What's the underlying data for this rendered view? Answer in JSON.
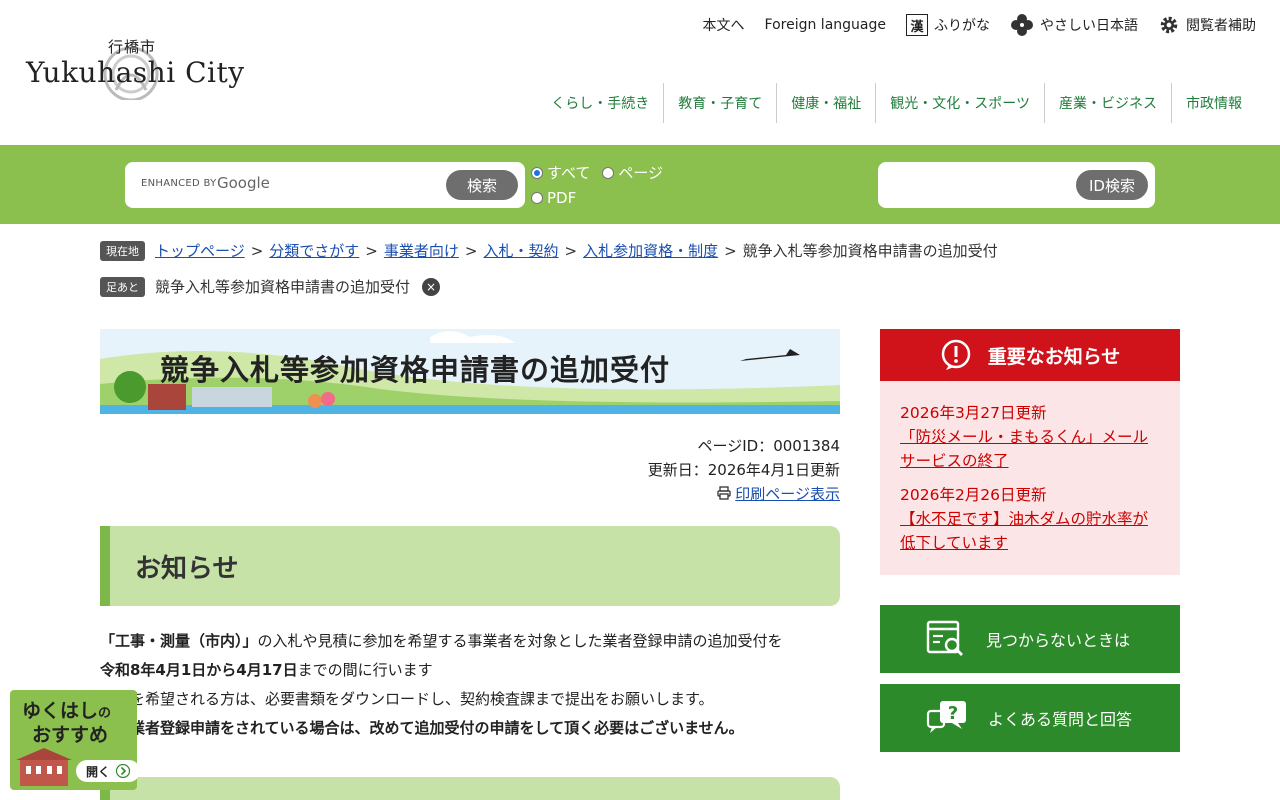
{
  "header": {
    "logo_kanji": "行橋市",
    "logo_en": "Yukuhashi City",
    "utility": {
      "skip": "本文へ",
      "foreign": "Foreign language",
      "furigana_icon": "漢",
      "furigana": "ふりがな",
      "easy_japanese": "やさしい日本語",
      "accessibility": "閲覧者補助"
    },
    "nav": [
      "くらし・手続き",
      "教育・子育て",
      "健康・福祉",
      "観光・文化・スポーツ",
      "産業・ビジネス",
      "市政情報"
    ]
  },
  "search": {
    "enhanced_by": "ENHANCED BY",
    "google": "Google",
    "button": "検索",
    "scope": {
      "all": "すべて",
      "page": "ページ",
      "pdf": "PDF"
    },
    "id_button": "ID検索"
  },
  "breadcrumb": {
    "tag": "現在地",
    "links": [
      "トップページ",
      "分類でさがす",
      "事業者向け",
      "入札・契約",
      "入札参加資格・制度"
    ],
    "current": "競争入札等参加資格申請書の追加受付",
    "sep": ">"
  },
  "footprint": {
    "tag": "足あと",
    "item": "競争入札等参加資格申請書の追加受付",
    "close": "×"
  },
  "main": {
    "title": "競争入札等参加資格申請書の追加受付",
    "page_id": "ページID：0001384",
    "updated": "更新日：2026年4月1日更新",
    "print": "印刷ページ表示",
    "section_heading": "お知らせ",
    "para1_bold": "「工事・測量（市内）」",
    "para1_rest": "の入札や見積に参加を希望する事業者を対象とした業者登録申請の追加受付を",
    "para2_bold": "令和8年4月1日から4月17日",
    "para2_rest": "までの間に行います",
    "para3": "申請を希望される方は、必要書類をダウンロードし、契約検査課まで提出をお願いします。",
    "para4": "既に業者登録申請をされている場合は、改めて追加受付の申請をして頂く必要はございません。"
  },
  "sidebar": {
    "notice_title": "重要なお知らせ",
    "notices": [
      {
        "date": "2026年3月27日更新",
        "text": "「防災メール・まもるくん」メールサービスの終了"
      },
      {
        "date": "2026年2月26日更新",
        "text": "【水不足です】油木ダムの貯水率が低下しています"
      }
    ],
    "not_found": "見つからないときは",
    "faq": "よくある質問と回答"
  },
  "recommend": {
    "line1": "ゆくはし",
    "line1_small": "の",
    "line2": "おすすめ",
    "open": "開く"
  },
  "colors": {
    "green_band": "#8bc04e",
    "nav_text": "#1f7d3a",
    "notice_red": "#d0121b",
    "button_green": "#2d8a2a",
    "heading_bg": "#c6e2a7"
  }
}
